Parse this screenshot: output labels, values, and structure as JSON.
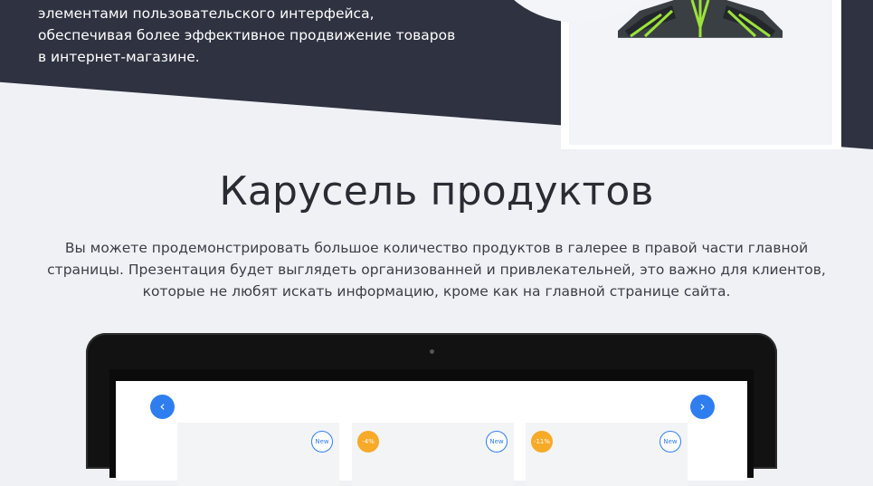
{
  "intro": {
    "text": "элементами пользовательского интерфейса, обеспечивая более эффективное продвижение товаров в интернет-магазине."
  },
  "section": {
    "title": "Карусель продуктов",
    "description": "Вы можете продемонстрировать большое количество продуктов в галерее в правой части главной страницы. Презентация будет выглядеть организованней и привлекательней, это важно для клиентов, которые не любят искать информацию, кроме как на главной странице сайта."
  },
  "carousel": {
    "prev_icon": "‹",
    "next_icon": "›",
    "cards": [
      {
        "badge_new": "New"
      },
      {
        "badge_sale": "-4%",
        "badge_new": "New"
      },
      {
        "badge_sale": "-11%",
        "badge_new": "New"
      }
    ]
  },
  "colors": {
    "dark_band": "#2f3240",
    "accent_blue": "#2f7ef0",
    "sale_orange": "#f7a928",
    "kite_green": "#9be23a"
  },
  "icons": {
    "prev": "chevron-left-icon",
    "next": "chevron-right-icon",
    "kite": "kite-illustration"
  }
}
